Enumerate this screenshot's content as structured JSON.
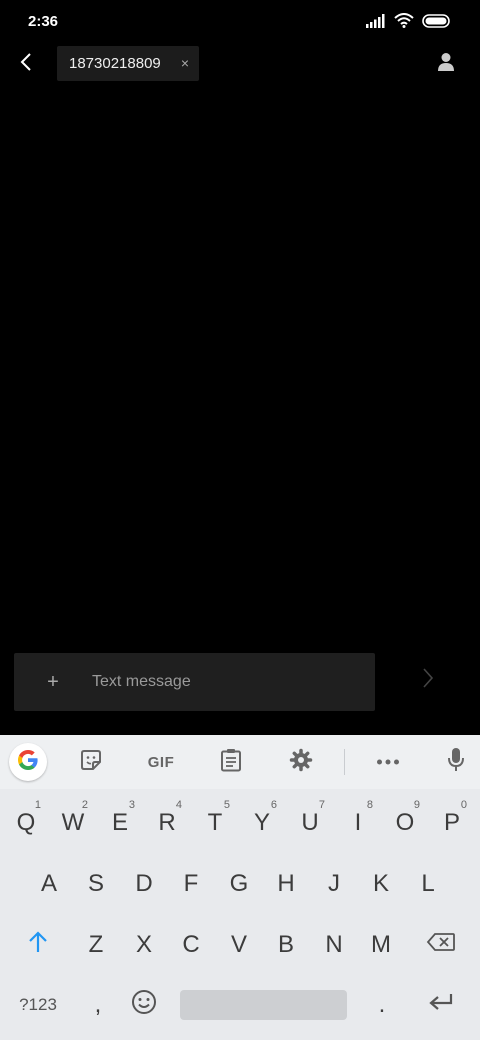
{
  "status_bar": {
    "time": "2:36",
    "icons": [
      "signal-icon",
      "wifi-icon",
      "battery-icon"
    ]
  },
  "header": {
    "back_icon": "back-arrow-icon",
    "recipient_chip": {
      "label": "18730218809",
      "close_glyph": "×"
    },
    "contact_icon": "person-icon"
  },
  "composer": {
    "attach_glyph": "+",
    "placeholder": "Text message",
    "send_icon": "send-chevron-icon"
  },
  "keyboard": {
    "toolbar": {
      "items": [
        "google-icon",
        "sticker-icon",
        "gif-button",
        "clipboard-icon",
        "gear-icon",
        "more-icon",
        "mic-icon"
      ],
      "gif_label": "GIF"
    },
    "rows": [
      [
        {
          "label": "Q",
          "hint": "1"
        },
        {
          "label": "W",
          "hint": "2"
        },
        {
          "label": "E",
          "hint": "3"
        },
        {
          "label": "R",
          "hint": "4"
        },
        {
          "label": "T",
          "hint": "5"
        },
        {
          "label": "Y",
          "hint": "6"
        },
        {
          "label": "U",
          "hint": "7"
        },
        {
          "label": "I",
          "hint": "8"
        },
        {
          "label": "O",
          "hint": "9"
        },
        {
          "label": "P",
          "hint": "0"
        }
      ],
      [
        {
          "label": "A"
        },
        {
          "label": "S"
        },
        {
          "label": "D"
        },
        {
          "label": "F"
        },
        {
          "label": "G"
        },
        {
          "label": "H"
        },
        {
          "label": "J"
        },
        {
          "label": "K"
        },
        {
          "label": "L"
        }
      ],
      [
        {
          "label": "Z"
        },
        {
          "label": "X"
        },
        {
          "label": "C"
        },
        {
          "label": "V"
        },
        {
          "label": "B"
        },
        {
          "label": "N"
        },
        {
          "label": "M"
        }
      ]
    ],
    "symbols_label": "?123",
    "comma_label": ",",
    "period_label": ".",
    "accent_color": "#2196f3"
  }
}
